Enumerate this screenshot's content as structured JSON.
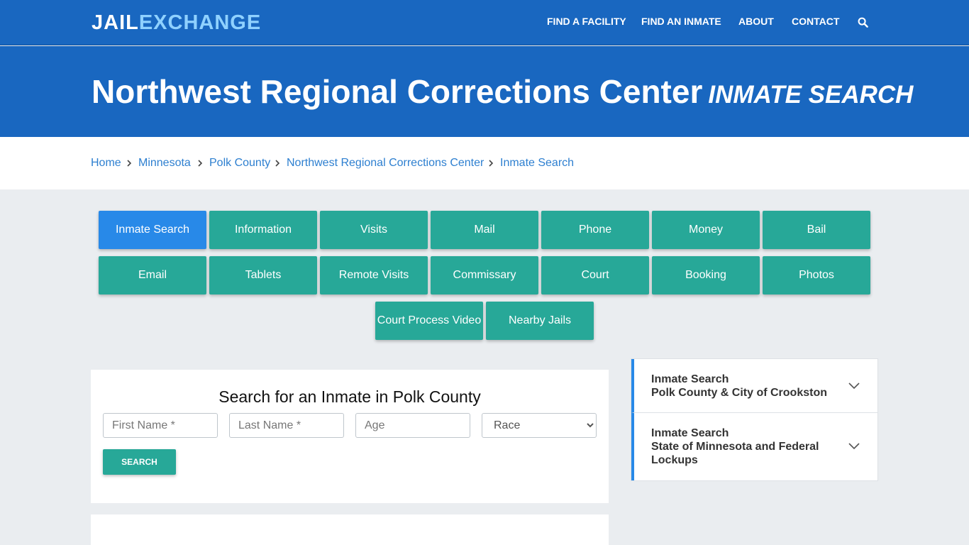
{
  "brand": {
    "logo_part1": "JAIL",
    "logo_part2": "EXCHANGE"
  },
  "nav": {
    "items": [
      "FIND A FACILITY",
      "FIND AN INMATE",
      "ABOUT",
      "CONTACT"
    ],
    "search_icon": "search-icon"
  },
  "hero": {
    "title": "Northwest Regional Corrections Center",
    "subtitle": "INMATE SEARCH"
  },
  "breadcrumb": [
    "Home",
    "Minnesota",
    "Polk County",
    "Northwest Regional Corrections Center",
    "Inmate Search"
  ],
  "tabs": {
    "row1": [
      "Inmate Search",
      "Information",
      "Visits",
      "Mail",
      "Phone",
      "Money",
      "Bail"
    ],
    "row2": [
      "Email",
      "Tablets",
      "Remote Visits",
      "Commissary",
      "Court",
      "Booking",
      "Photos"
    ],
    "row3": [
      "Court Process Video",
      "Nearby Jails"
    ],
    "active": "Inmate Search"
  },
  "search_form": {
    "heading": "Search for an Inmate in Polk County",
    "first_name_placeholder": "First Name *",
    "last_name_placeholder": "Last Name *",
    "age_placeholder": "Age",
    "race_selected": "Race",
    "button": "SEARCH"
  },
  "sidebar": {
    "items": [
      {
        "line1": "Inmate Search",
        "line2": "Polk County & City of Crookston"
      },
      {
        "line1": "Inmate Search",
        "line2": "State of Minnesota and Federal",
        "line3": "Lockups"
      }
    ]
  },
  "colors": {
    "primary_blue": "#1967c0",
    "teal": "#27a898",
    "active_blue": "#2889e8",
    "link_blue": "#2d7fd0"
  }
}
